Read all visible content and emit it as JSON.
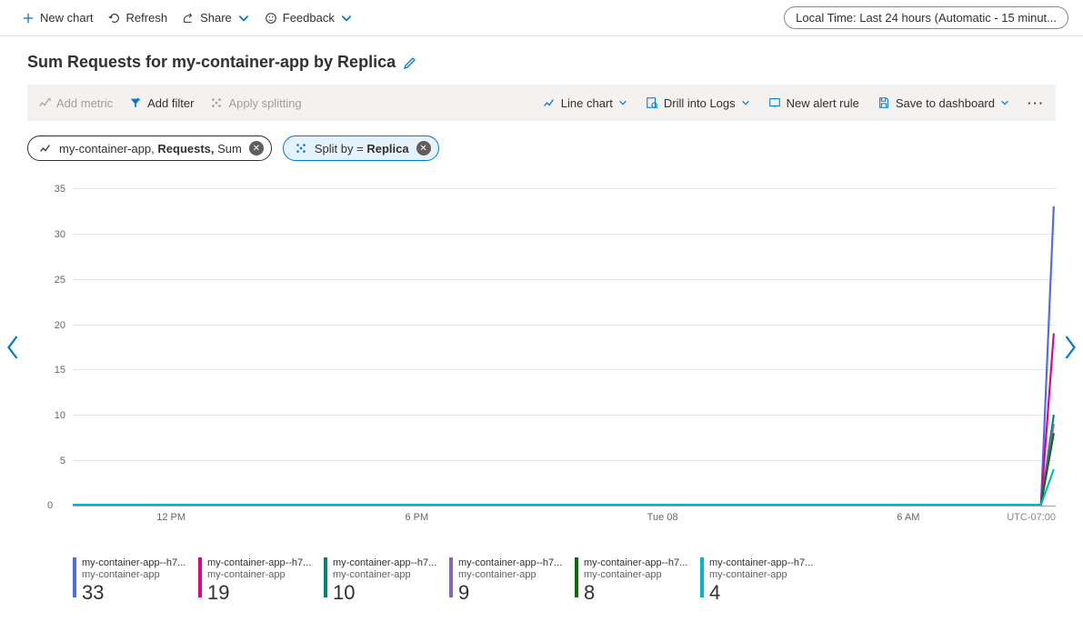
{
  "top_toolbar": {
    "new_chart": "New chart",
    "refresh": "Refresh",
    "share": "Share",
    "feedback": "Feedback",
    "time_range": "Local Time: Last 24 hours (Automatic - 15 minut..."
  },
  "chart_title": "Sum Requests for my-container-app by Replica",
  "gray_bar": {
    "add_metric": "Add metric",
    "add_filter": "Add filter",
    "apply_splitting": "Apply splitting",
    "line_chart": "Line chart",
    "drill_logs": "Drill into Logs",
    "new_alert": "New alert rule",
    "save_dashboard": "Save to dashboard"
  },
  "metric_pill": {
    "resource": "my-container-app, ",
    "metric": "Requests, ",
    "agg": "Sum"
  },
  "split_pill": {
    "prefix": "Split by = ",
    "value": "Replica"
  },
  "y_ticks": [
    "0",
    "5",
    "10",
    "15",
    "20",
    "25",
    "30",
    "35"
  ],
  "x_ticks": [
    "12 PM",
    "6 PM",
    "Tue 08",
    "6 AM"
  ],
  "tz": "UTC-07:00",
  "legend": [
    {
      "name": "my-container-app--h7...",
      "sub": "my-container-app",
      "value": "33",
      "color": "#4f6bed"
    },
    {
      "name": "my-container-app--h7...",
      "sub": "my-container-app",
      "value": "19",
      "color": "#e3008c"
    },
    {
      "name": "my-container-app--h7...",
      "sub": "my-container-app",
      "value": "10",
      "color": "#008575"
    },
    {
      "name": "my-container-app--h7...",
      "sub": "my-container-app",
      "value": "9",
      "color": "#8764b8"
    },
    {
      "name": "my-container-app--h7...",
      "sub": "my-container-app",
      "value": "8",
      "color": "#0b6a0b"
    },
    {
      "name": "my-container-app--h7...",
      "sub": "my-container-app",
      "value": "4",
      "color": "#00b7c3"
    }
  ],
  "chart_data": {
    "type": "line",
    "title": "Sum Requests for my-container-app by Replica",
    "xlabel": "",
    "ylabel": "",
    "ylim": [
      0,
      35
    ],
    "x_range_hours": 24,
    "x_ticks": [
      "12 PM",
      "6 PM",
      "Tue 08",
      "6 AM"
    ],
    "timezone": "UTC-07:00",
    "note": "All series are ~0 across the entire window except a spike at the final timestamp on the right edge.",
    "series": [
      {
        "name": "my-container-app--h7... (replica 1)",
        "color": "#4f6bed",
        "baseline": 0,
        "final_value": 33
      },
      {
        "name": "my-container-app--h7... (replica 2)",
        "color": "#e3008c",
        "baseline": 0,
        "final_value": 19
      },
      {
        "name": "my-container-app--h7... (replica 3)",
        "color": "#008575",
        "baseline": 0,
        "final_value": 10
      },
      {
        "name": "my-container-app--h7... (replica 4)",
        "color": "#8764b8",
        "baseline": 0,
        "final_value": 9
      },
      {
        "name": "my-container-app--h7... (replica 5)",
        "color": "#0b6a0b",
        "baseline": 0,
        "final_value": 8
      },
      {
        "name": "my-container-app--h7... (replica 6)",
        "color": "#00b7c3",
        "baseline": 0,
        "final_value": 4
      }
    ]
  }
}
